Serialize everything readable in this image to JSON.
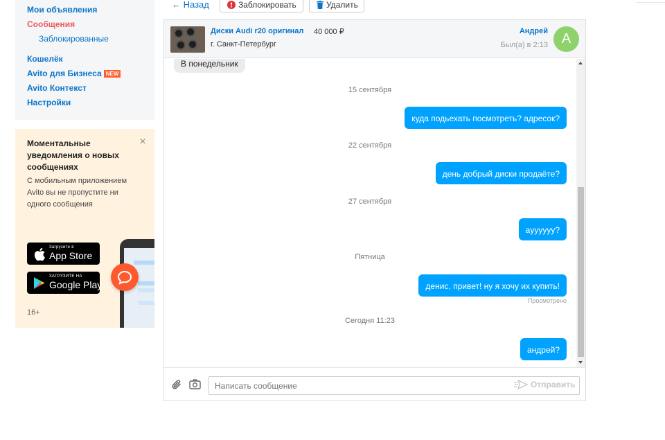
{
  "sidebar": {
    "items": [
      {
        "label": "Мои объявления"
      },
      {
        "label": "Сообщения"
      },
      {
        "label": "Заблокированные"
      },
      {
        "label": "Кошелёк"
      },
      {
        "label": "Avito для Бизнеса",
        "badge": "NEW"
      },
      {
        "label": "Avito Контекст"
      },
      {
        "label": "Настройки"
      }
    ]
  },
  "promo": {
    "title": "Моментальные уведомления о новых сообщениях",
    "text": "С мобильным приложением Avito вы не пропустите ни одного сообщения",
    "app_store_small": "Загрузите в",
    "app_store_big": "App Store",
    "google_play_small": "ЗАГРУЗИТЕ НА",
    "google_play_big": "Google Play",
    "age": "16+"
  },
  "toolbar": {
    "back_label": "← Назад",
    "block_label": "Заблокировать",
    "delete_label": "Удалить"
  },
  "chat_header": {
    "ad_title": "Диски Audi r20 оригинал",
    "ad_price": "40 000 ₽",
    "ad_city": "г. Санкт-Петербург",
    "user_name": "Андрей",
    "user_status": "Был(а) в 2:13",
    "avatar_letter": "A"
  },
  "messages": {
    "incoming_1": "В понедельник",
    "date_1": "15 сентября",
    "out_1": "куда подьехать посмотреть? адресок?",
    "date_2": "22 сентября",
    "out_2": "день добрый диски продаёте?",
    "date_3": "27 сентября",
    "out_3": "ayyyyyy?",
    "date_4": "Пятница",
    "out_4": "денис, привет! ну я хочу их купить!",
    "seen": "Просмотрено",
    "date_5": "Сегодня 11:23",
    "out_5": "андрей?"
  },
  "composer": {
    "placeholder": "Написать сообщение",
    "send_label": "Отправить"
  },
  "colors": {
    "link": "#0a75c9",
    "active": "#f0595a",
    "bubble_out": "#00a2ff",
    "avatar": "#8fd16b"
  }
}
